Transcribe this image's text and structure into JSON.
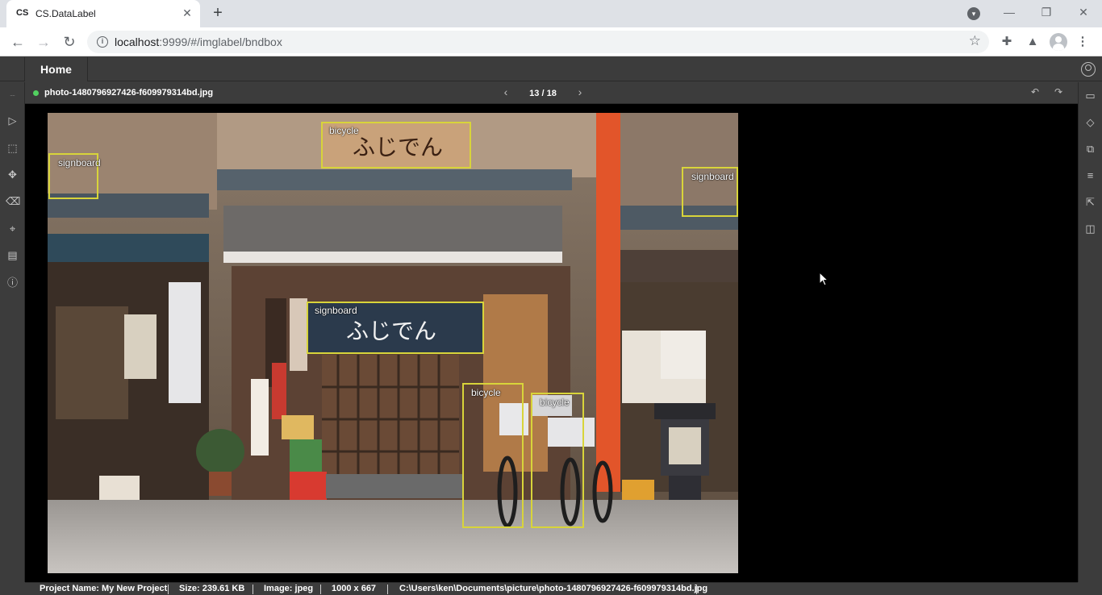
{
  "browser": {
    "tab": {
      "favicon_text": "CS",
      "title": "CS.DataLabel"
    },
    "url_host": "localhost",
    "url_rest": ":9999/#/imglabel/bndbox"
  },
  "app": {
    "nav": {
      "home": "Home"
    },
    "file": {
      "name": "photo-1480796927426-f609979314bd.jpg",
      "status_color": "#52d160",
      "pager": "13 / 18"
    },
    "annotations": [
      {
        "label": "bicycle"
      },
      {
        "label": "signboard"
      },
      {
        "label": "signboard"
      },
      {
        "label": "signboard"
      },
      {
        "label": "bicycle"
      },
      {
        "label": "bicycle"
      }
    ],
    "bbox_color": "#d8d43a",
    "status": {
      "project": "Project Name: My New Project",
      "size": "Size: 239.61 KB",
      "image": "Image: jpeg",
      "dims": "1000 x 667",
      "path": "C:\\Users\\ken\\Documents\\picture\\photo-1480796927426-f609979314bd.jpg"
    }
  }
}
